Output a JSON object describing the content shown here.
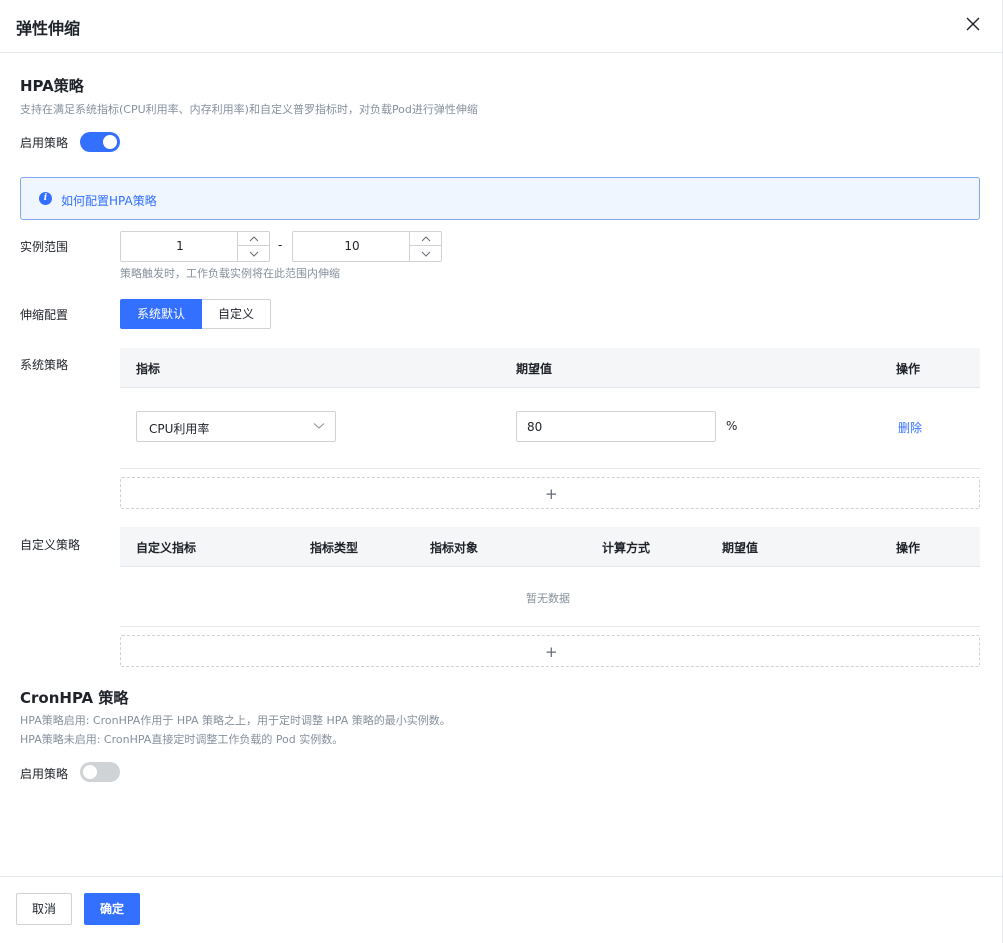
{
  "dialog": {
    "title": "弹性伸缩"
  },
  "hpa": {
    "title": "HPA策略",
    "description": "支持在满足系统指标(CPU利用率、内存利用率)和自定义普罗指标时，对负载Pod进行弹性伸缩",
    "enable_label": "启用策略",
    "enabled": true,
    "info_link": "如何配置HPA策略",
    "instance_range": {
      "label": "实例范围",
      "min": "1",
      "separator": "-",
      "max": "10",
      "hint": "策略触发时，工作负载实例将在此范围内伸缩"
    },
    "scaling_config": {
      "label": "伸缩配置",
      "options": [
        "系统默认",
        "自定义"
      ],
      "selected": "系统默认"
    },
    "system_policy": {
      "label": "系统策略",
      "columns": [
        "指标",
        "期望值",
        "操作"
      ],
      "rows": [
        {
          "metric": "CPU利用率",
          "expected": "80",
          "unit": "%",
          "action": "删除"
        }
      ],
      "add": "+"
    },
    "custom_policy": {
      "label": "自定义策略",
      "columns": [
        "自定义指标",
        "指标类型",
        "指标对象",
        "计算方式",
        "期望值",
        "操作"
      ],
      "empty": "暂无数据",
      "add": "+"
    }
  },
  "cron": {
    "title": "CronHPA 策略",
    "desc_line1": "HPA策略启用: CronHPA作用于 HPA 策略之上，用于定时调整 HPA 策略的最小实例数。",
    "desc_line2": "HPA策略未启用: CronHPA直接定时调整工作负载的 Pod 实例数。",
    "enable_label": "启用策略",
    "enabled": false
  },
  "footer": {
    "cancel": "取消",
    "confirm": "确定"
  },
  "colors": {
    "primary": "#3370ff",
    "border": "#d0d3d6",
    "muted": "#86909c"
  }
}
